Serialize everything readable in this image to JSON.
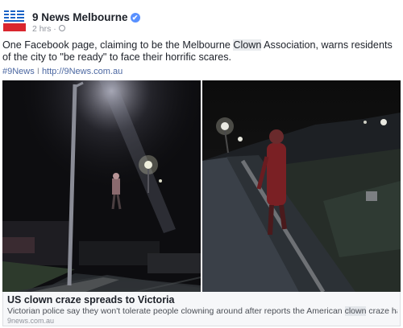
{
  "header": {
    "page_name": "9 News Melbourne",
    "verified_mark": "✔",
    "timestamp": "2 hrs",
    "privacy_sep": "·"
  },
  "logo": {
    "lines": [
      "9",
      "NEWS"
    ],
    "colors": {
      "blue": "#1a63c6",
      "red": "#d9262e"
    }
  },
  "post": {
    "text_before": "One Facebook page, claiming to be the Melbourne ",
    "text_highlight": "Clown",
    "text_after": " Association, warns residents of the city to \"be ready\" to face their horrific scares.",
    "hashtag": "#9News",
    "separator": "I",
    "link": "http://9News.com.au"
  },
  "photos": {
    "left_icon": "night-street-photo",
    "right_icon": "night-clown-photo"
  },
  "card": {
    "title": "US clown craze spreads to Victoria",
    "desc_before": "Victorian police say they won't tolerate people clowning around after reports the American ",
    "desc_highlight": "clown",
    "desc_after": " craze has spread to A...",
    "domain": "9news.com.au"
  },
  "colors": {
    "link_blue": "#4b67a1",
    "verified_blue": "#5890ff",
    "muted_gray": "#90949c"
  }
}
